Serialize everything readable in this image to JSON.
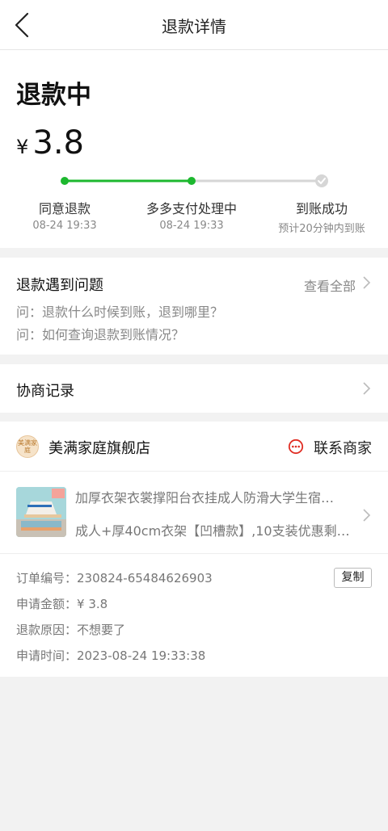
{
  "header": {
    "title": "退款详情"
  },
  "refund": {
    "status": "退款中",
    "currency": "¥",
    "amount": "3.8",
    "steps": [
      {
        "label": "同意退款",
        "time": "08-24 19:33"
      },
      {
        "label": "多多支付处理中",
        "time": "08-24 19:33"
      },
      {
        "label": "到账成功",
        "time": "预计20分钟内到账"
      }
    ],
    "colors": {
      "active": "#1db82f",
      "inactive": "#d6d6d6"
    }
  },
  "faq": {
    "title": "退款遇到问题",
    "view_all": "查看全部",
    "questions": [
      "问：退款什么时候到账，退到哪里？",
      "问：如何查询退款到账情况？"
    ]
  },
  "negotiation": {
    "title": "协商记录"
  },
  "shop": {
    "logo_text": "美满家庭",
    "name": "美满家庭旗舰店",
    "contact_label": "联系商家",
    "contact_color": "#e02e24"
  },
  "product": {
    "title": "加厚衣架衣裳撑阳台衣挂成人防滑大学生宿…",
    "spec": "成人+厚40cm衣架【凹槽款】,10支装优惠剩…"
  },
  "order": {
    "order_no_label": "订单编号：",
    "order_no": "230824-65484626903",
    "copy_label": "复制",
    "amount_label": "申请金额：",
    "amount": "¥ 3.8",
    "reason_label": "退款原因：",
    "reason": "不想要了",
    "time_label": "申请时间：",
    "time": "2023-08-24 19:33:38"
  }
}
